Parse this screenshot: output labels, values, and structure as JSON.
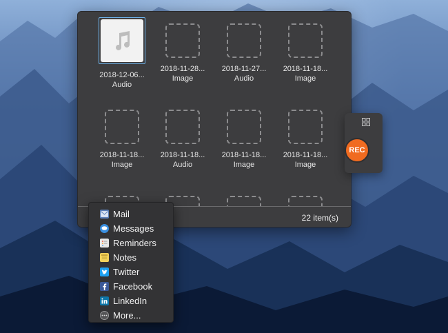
{
  "colors": {
    "panel_bg": "#3d3d3f",
    "rec_accent": "#f06b20",
    "selection_border": "#6fb3ea"
  },
  "file_grid": {
    "items": [
      {
        "date": "2018-12-06...",
        "type": "Audio",
        "selected": true,
        "icon": "music-note-icon"
      },
      {
        "date": "2018-11-28...",
        "type": "Image"
      },
      {
        "date": "2018-11-27...",
        "type": "Audio"
      },
      {
        "date": "2018-11-18...",
        "type": "Image"
      },
      {
        "date": "2018-11-18...",
        "type": "Image"
      },
      {
        "date": "2018-11-18...",
        "type": "Audio"
      },
      {
        "date": "2018-11-18...",
        "type": "Image"
      },
      {
        "date": "2018-11-18...",
        "type": "Image"
      }
    ],
    "count_label": "22 item(s)"
  },
  "side_widget": {
    "grid_icon": "grid-icon",
    "rec_label": "REC"
  },
  "share_menu": {
    "items": [
      {
        "label": "Mail",
        "icon": "mail-icon",
        "color": "#5b7fb8"
      },
      {
        "label": "Messages",
        "icon": "messages-icon",
        "color": "#3a8fe0"
      },
      {
        "label": "Reminders",
        "icon": "reminders-icon",
        "color": "#e8e8e8"
      },
      {
        "label": "Notes",
        "icon": "notes-icon",
        "color": "#f2d15b"
      },
      {
        "label": "Twitter",
        "icon": "twitter-icon",
        "color": "#1da1f2"
      },
      {
        "label": "Facebook",
        "icon": "facebook-icon",
        "color": "#3b5998"
      },
      {
        "label": "LinkedIn",
        "icon": "linkedin-icon",
        "color": "#0e76a8"
      },
      {
        "label": "More...",
        "icon": "more-icon",
        "color": "#555557"
      }
    ]
  }
}
